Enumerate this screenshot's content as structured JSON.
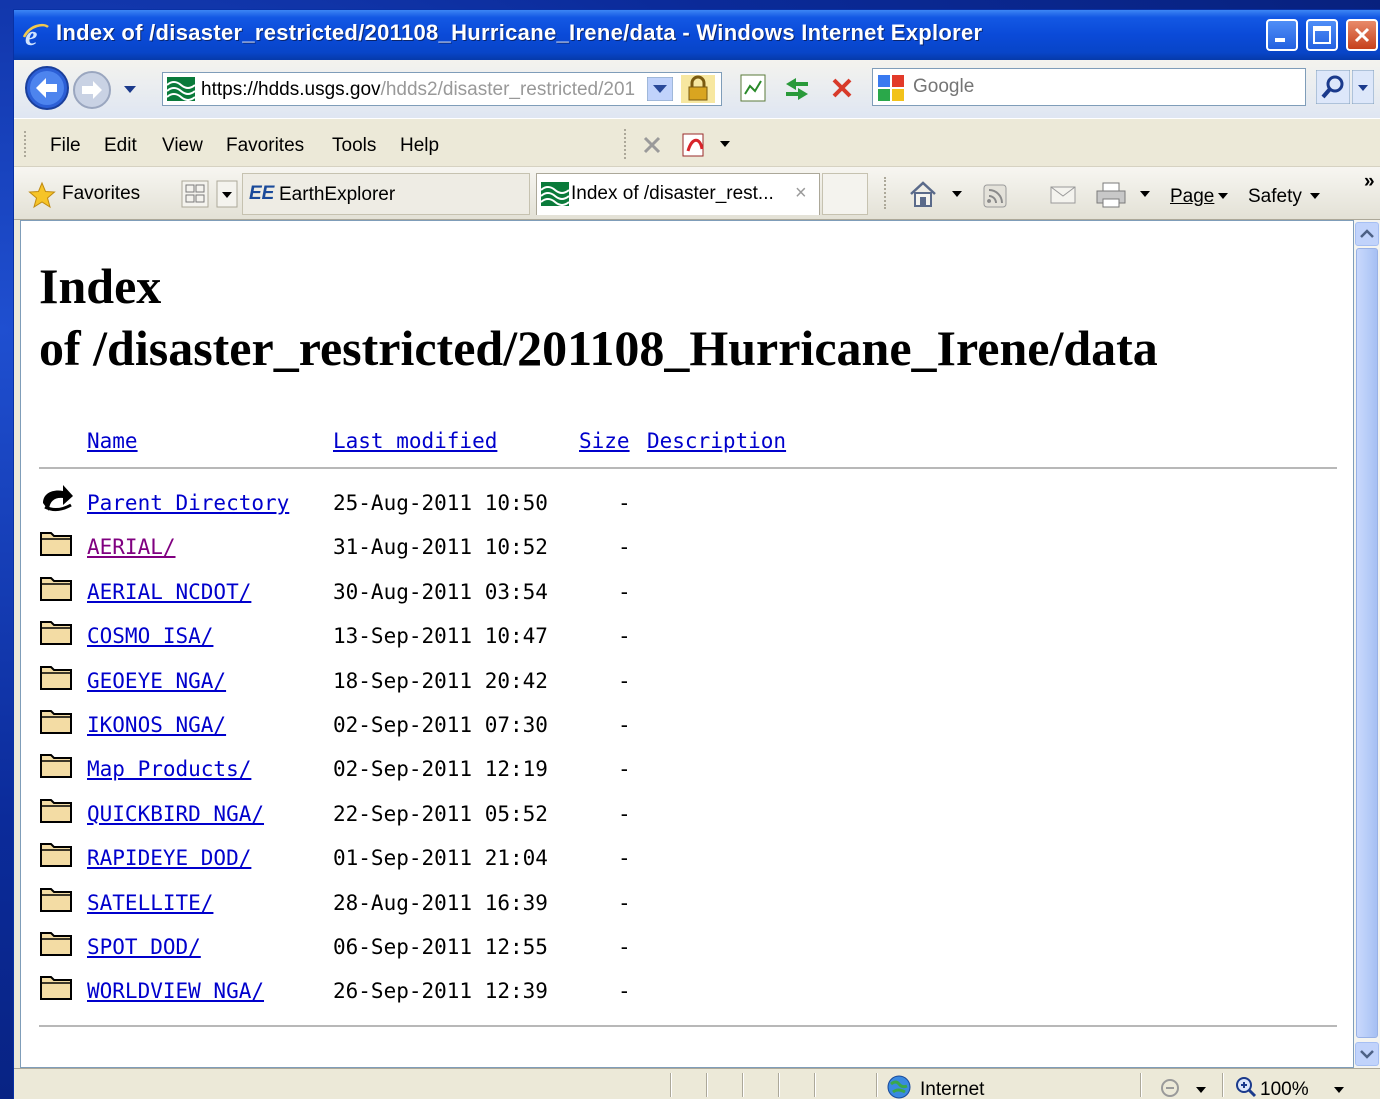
{
  "window": {
    "title": "Index of /disaster_restricted/201108_Hurricane_Irene/data - Windows Internet Explorer"
  },
  "address": {
    "protocol": "https://",
    "host": "hdds.usgs.gov",
    "path": "/hdds2/disaster_restricted/201"
  },
  "search": {
    "placeholder": "Google"
  },
  "menu": [
    "File",
    "Edit",
    "View",
    "Favorites",
    "Tools",
    "Help"
  ],
  "favorites": {
    "label": "Favorites",
    "tabs": [
      {
        "label": "EarthExplorer",
        "prefix": "EE"
      },
      {
        "label": "Index of /disaster_rest...",
        "close": "×"
      }
    ]
  },
  "command_bar": {
    "page": "Page",
    "safety": "Safety",
    "more": "»"
  },
  "page": {
    "title_line1": "Index",
    "title_line2": "of /disaster_restricted/201108_Hurricane_Irene/data",
    "headers": {
      "name": "Name",
      "last_modified": "Last modified",
      "size": "Size",
      "description": "Description"
    },
    "rows": [
      {
        "name": "Parent Directory",
        "date": "25-Aug-2011 10:50",
        "size": "-",
        "icon": "back-arrow",
        "visited": false
      },
      {
        "name": "AERIAL/",
        "date": "31-Aug-2011 10:52",
        "size": "-",
        "icon": "folder",
        "visited": true
      },
      {
        "name": "AERIAL NCDOT/",
        "date": "30-Aug-2011 03:54",
        "size": "-",
        "icon": "folder",
        "visited": false
      },
      {
        "name": "COSMO ISA/",
        "date": "13-Sep-2011 10:47",
        "size": "-",
        "icon": "folder",
        "visited": false
      },
      {
        "name": "GEOEYE NGA/",
        "date": "18-Sep-2011 20:42",
        "size": "-",
        "icon": "folder",
        "visited": false
      },
      {
        "name": "IKONOS NGA/",
        "date": "02-Sep-2011 07:30",
        "size": "-",
        "icon": "folder",
        "visited": false
      },
      {
        "name": "Map Products/",
        "date": "02-Sep-2011 12:19",
        "size": "-",
        "icon": "folder",
        "visited": false
      },
      {
        "name": "QUICKBIRD NGA/",
        "date": "22-Sep-2011 05:52",
        "size": "-",
        "icon": "folder",
        "visited": false
      },
      {
        "name": "RAPIDEYE DOD/",
        "date": "01-Sep-2011 21:04",
        "size": "-",
        "icon": "folder",
        "visited": false
      },
      {
        "name": "SATELLITE/",
        "date": "28-Aug-2011 16:39",
        "size": "-",
        "icon": "folder",
        "visited": false
      },
      {
        "name": "SPOT DOD/",
        "date": "06-Sep-2011 12:55",
        "size": "-",
        "icon": "folder",
        "visited": false
      },
      {
        "name": "WORLDVIEW NGA/",
        "date": "26-Sep-2011 12:39",
        "size": "-",
        "icon": "folder",
        "visited": false
      }
    ]
  },
  "status": {
    "zone": "Internet",
    "zoom": "100%"
  },
  "colors": {
    "link": "#0000cc",
    "visited": "#800080",
    "title_bar": "#0a4ad8"
  }
}
